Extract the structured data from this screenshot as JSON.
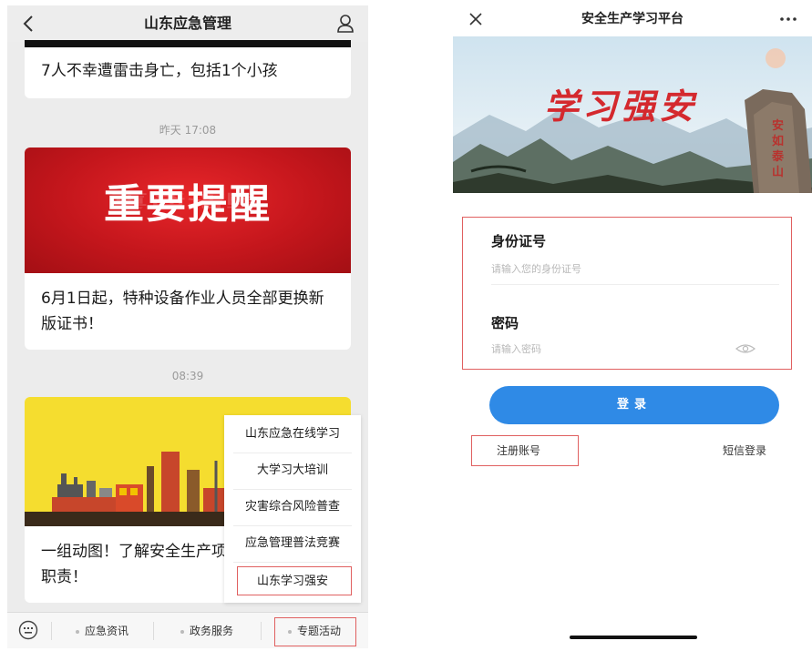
{
  "left": {
    "nav_title": "山东应急管理",
    "messages": [
      {
        "text": "7人不幸遭雷击身亡，包括1个小孩"
      },
      {
        "timestamp": "昨天 17:08",
        "banner_text": "重要提醒",
        "banner_reflection": "重要提醒",
        "text": "6月1日起，特种设备作业人员全部更换新版证书！"
      },
      {
        "timestamp": "08:39",
        "text": "一组动图！了解安全生产项职责！"
      }
    ],
    "popup_menu": {
      "items": [
        "山东应急在线学习",
        "大学习大培训",
        "灾害综合风险普查",
        "应急管理普法竞赛",
        "山东学习强安"
      ]
    },
    "bottom_tabs": [
      "应急资讯",
      "政务服务",
      "专题活动"
    ]
  },
  "right": {
    "nav_title": "安全生产学习平台",
    "hero_title": "学习强安",
    "hero_rock_text": "安如泰山",
    "id_field": {
      "label": "身份证号",
      "placeholder": "请输入您的身份证号"
    },
    "password_field": {
      "label": "密码",
      "placeholder": "请输入密码"
    },
    "login_button": "登录",
    "register_link": "注册账号",
    "sms_login_link": "短信登录"
  },
  "colors": {
    "annotation_box": "#e06060",
    "login_button": "#2f8ae6",
    "banner_red": "#c4161c",
    "banner_yellow": "#f5dd2f",
    "hero_title": "#d4292e"
  },
  "icons": {
    "back": "chevron-left-icon",
    "profile": "person-icon",
    "keyboard": "keyboard-icon",
    "close": "close-icon",
    "more": "more-icon",
    "eye": "eye-icon"
  }
}
